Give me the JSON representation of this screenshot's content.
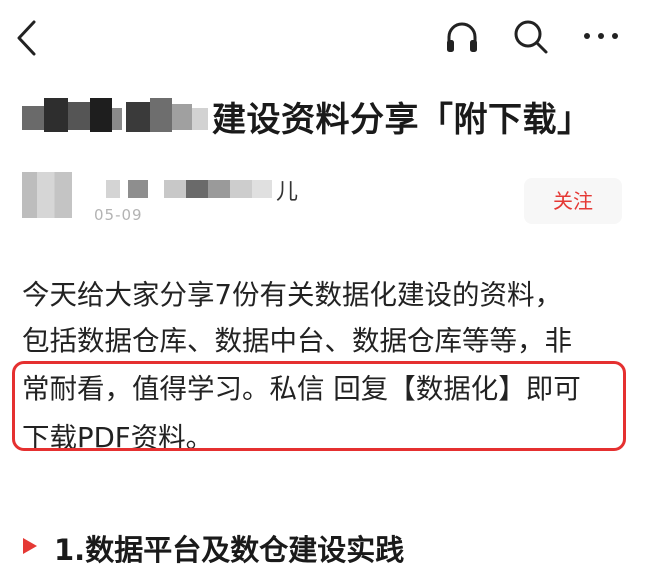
{
  "header": {
    "back_icon": "chevron-left-icon",
    "headphone_icon": "headphone-icon",
    "search_icon": "search-icon",
    "more_icon": "more-horizontal-icon"
  },
  "article": {
    "title_visible": "建设资料分享「附下载」",
    "author_suffix": "儿",
    "date": "05-09",
    "follow_label": "关注"
  },
  "body": {
    "line1": "今天给大家分享7份有关数据化建设的资料，",
    "line2": "包括数据仓库、数据中台、数据仓库等等，非",
    "line3": "常耐看，值得学习。私信 回复【数据化】即可",
    "line4": "下载PDF资料。"
  },
  "section": {
    "heading": "1.数据平台及数仓建设实践"
  },
  "colors": {
    "accent_red": "#e53935",
    "highlight_border": "#e53030",
    "date_gray": "#b3b3b3"
  }
}
